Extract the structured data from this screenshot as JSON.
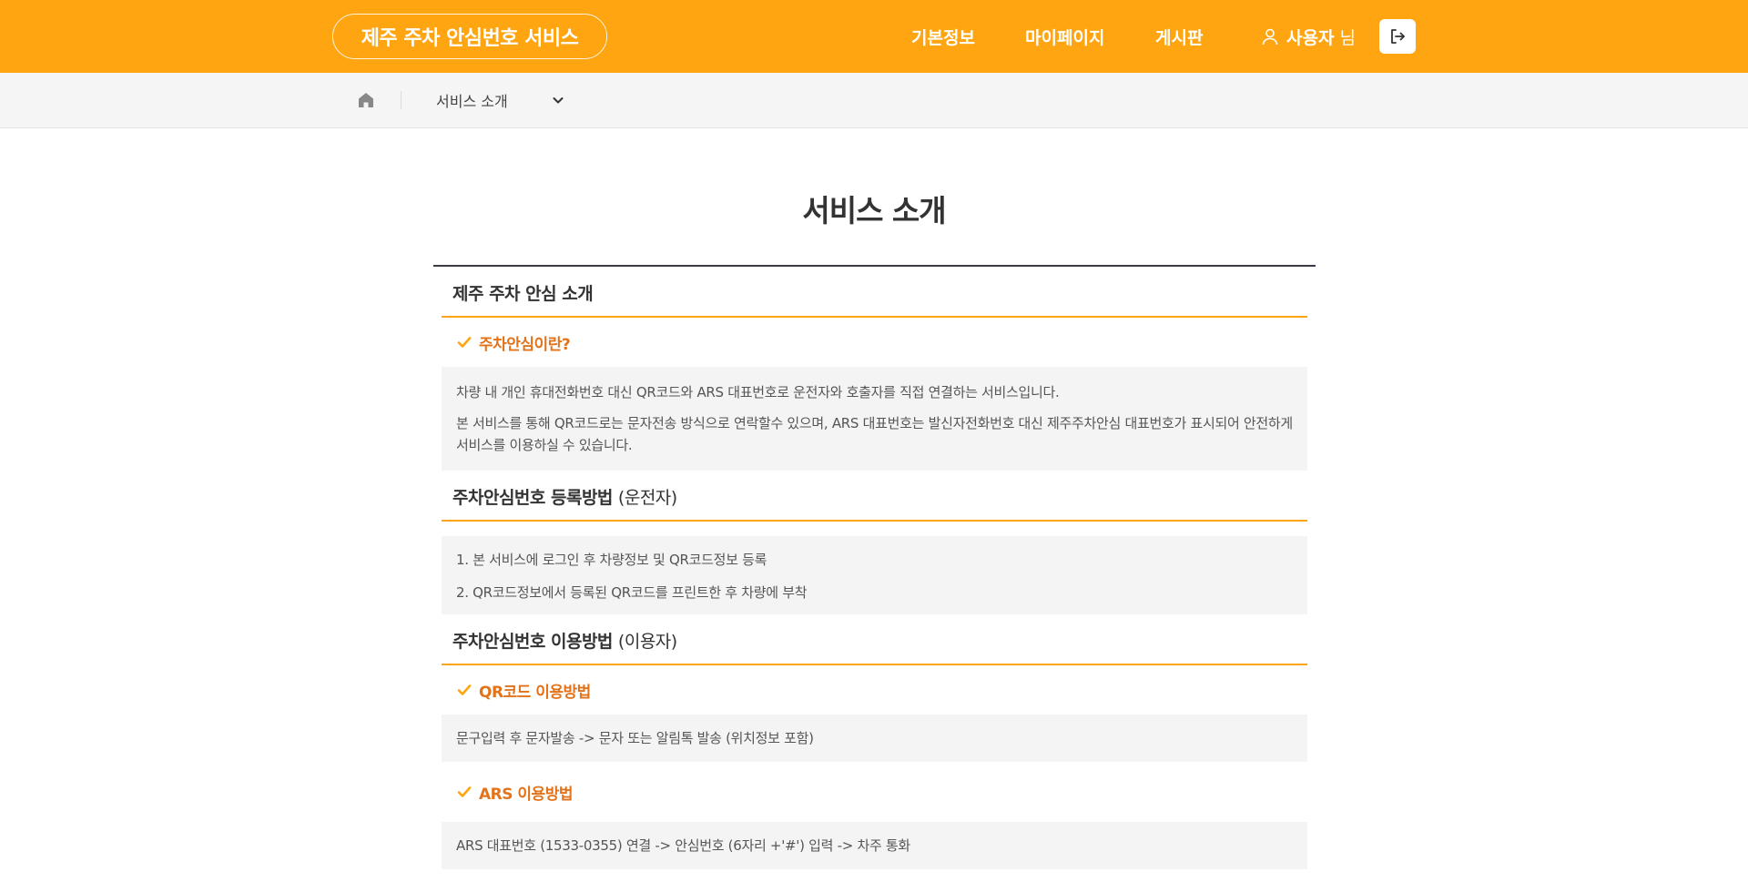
{
  "header": {
    "logo": "제주 주차 안심번호 서비스",
    "nav": [
      "기본정보",
      "마이페이지",
      "게시판"
    ],
    "user_name": "사용자",
    "user_suffix": "님",
    "accent_color": "#fea511"
  },
  "subbar": {
    "home_icon": "home-icon",
    "breadcrumb": "서비스 소개",
    "dropdown_icon": "chevron-down-icon"
  },
  "page": {
    "title": "서비스 소개"
  },
  "sections": [
    {
      "title": "제주 주차 안심 소개",
      "subtitle": "주차안심이란?",
      "lines": [
        "차량 내 개인 휴대전화번호 대신 QR코드와 ARS 대표번호로 운전자와 호출자를 직접 연결하는 서비스입니다.",
        "본 서비스를 통해 QR코드로는 문자전송 방식으로 연락할수 있으며, ARS 대표번호는 발신자전화번호 대신 제주주차안심 대표번호가 표시되어 안전하게 서비스를 이용하실 수 있습니다."
      ]
    },
    {
      "title": "주차안심번호 등록방법",
      "title_paren": "(운전자)",
      "lines": [
        "1. 본 서비스에 로그인 후 차량정보 및 QR코드정보 등록",
        "2. QR코드정보에서 등록된 QR코드를 프린트한 후 차량에 부착"
      ]
    },
    {
      "title": "주차안심번호 이용방법",
      "title_paren": "(이용자)",
      "sub_items": [
        {
          "subtitle": "QR코드 이용방법",
          "text": "문구입력 후 문자발송 -> 문자 또는 알림톡 발송 (위치정보 포함)"
        },
        {
          "subtitle": "ARS 이용방법",
          "text": "ARS 대표번호 (1533-0355) 연결 -> 안심번호 (6자리 +'#') 입력 -> 차주 통화"
        }
      ]
    }
  ]
}
